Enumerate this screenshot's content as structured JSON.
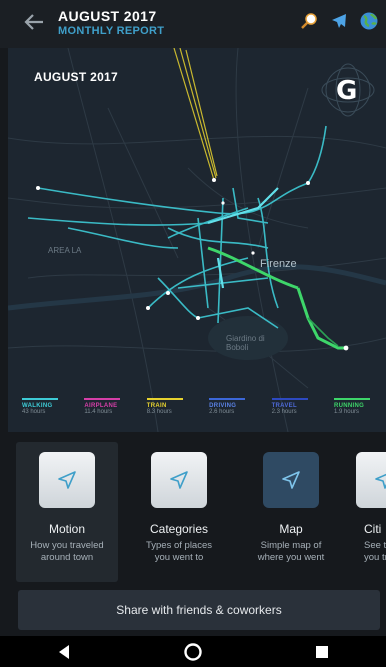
{
  "header": {
    "title": "AUGUST 2017",
    "subtitle": "MONTHLY REPORT",
    "icons": [
      "search-icon",
      "airplane-icon",
      "globe-icon"
    ]
  },
  "map": {
    "title": "AUGUST 2017",
    "logo": "G",
    "city": "Firenze",
    "street_labels": [
      "AREA LA",
      "Giardino di Boboli"
    ],
    "legend": [
      {
        "name": "WALKING",
        "value": "43 hours",
        "color": "#3ecbd6"
      },
      {
        "name": "AIRPLANE",
        "value": "11.4 hours",
        "color": "#d63fa8"
      },
      {
        "name": "TRAIN",
        "value": "8.3 hours",
        "color": "#e7d22f"
      },
      {
        "name": "DRIVING",
        "value": "2.6 hours",
        "color": "#3c67d8"
      },
      {
        "name": "TRAVEL",
        "value": "2.3 hours",
        "color": "#2d49c0"
      },
      {
        "name": "RUNNING",
        "value": "1.9 hours",
        "color": "#3ed66a"
      }
    ]
  },
  "tiles": [
    {
      "name": "Motion",
      "desc1": "How you traveled",
      "desc2": "around town"
    },
    {
      "name": "Categories",
      "desc1": "Types of places",
      "desc2": "you went to"
    },
    {
      "name": "Map",
      "desc1": "Simple map of",
      "desc2": "where you went"
    },
    {
      "name": "Citi",
      "desc1": "See the p",
      "desc2": "you trav"
    }
  ],
  "share": {
    "label": "Share with friends & coworkers"
  },
  "colors": {
    "accent": "#3f9fc9",
    "walking": "#3ecbd6",
    "running": "#3ed66a",
    "train": "#e7d22f"
  }
}
